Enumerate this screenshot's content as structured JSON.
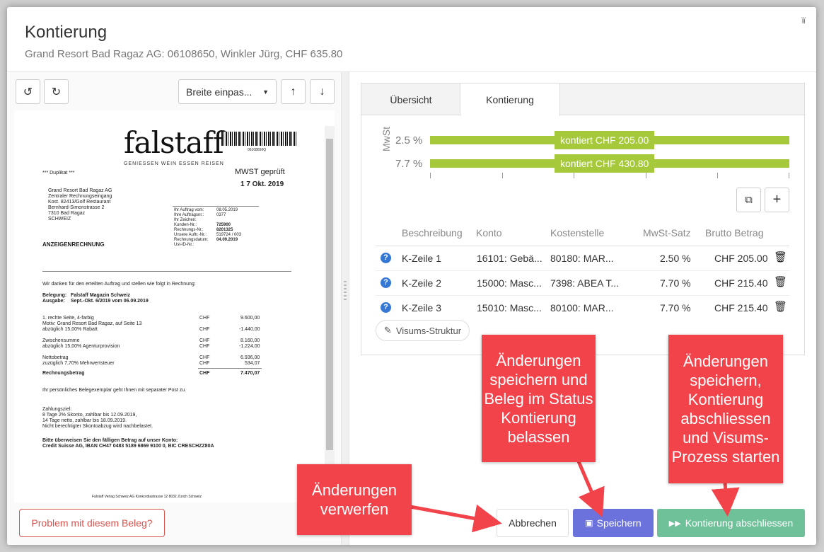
{
  "header": {
    "title": "Kontierung",
    "subtitle": "Grand Resort Bad Ragaz AG: 06108650, Winkler Jürg, CHF 635.80",
    "corner": "ïï"
  },
  "toolbar": {
    "zoom_value": "Breite einpas...",
    "rotate_left": "↺",
    "rotate_right": "↻",
    "up": "↑",
    "down": "↓"
  },
  "doc": {
    "logo": "falstaff",
    "tagline": "GENIESSEN WEIN ESSEN REISEN",
    "barcode_num": "06108650Q",
    "duplikat": "*** Duplikat ***",
    "stamp1": "MWST geprüft",
    "stamp2": "1 7 Okt. 2019",
    "addr": [
      "Grand Resort Bad Ragaz AG",
      "Zentraler Rechnungseingang",
      "Kost. 82413/Golf Restaurant",
      "Bernhard-Simonstrasse 2",
      "7310 Bad Ragaz",
      "SCHWEIZ"
    ],
    "meta_labels": [
      "Ihr Auftrag vom:",
      "Ihre Auftragsnr.:",
      "Ihr Zeichen:",
      "Kunden-Nr.:",
      "Rechnungs-Nr.:",
      "Unsere Auftr.-Nr.:",
      "Rechnungsdatum:",
      "Ust-ID-Nr.:"
    ],
    "meta_values": [
      "08.05.2019",
      "0377",
      "",
      "725900",
      "8201325",
      "519724 / 003",
      "04.09.2019",
      ""
    ],
    "doctitle": "ANZEIGENRECHNUNG",
    "thanks": "Wir danken für den erteilten Auftrag und stellen wie folgt in Rechnung:",
    "beleg_label": "Belegung:",
    "beleg_val": "Falstaff Magazin Schweiz",
    "ausg_label": "Ausgabe:",
    "ausg_val": "Sept.-Okt. 6/2019 vom 06.09.2019",
    "line1": "1. rechte Seite, 4-farbig",
    "line1b": "Motiv: Grand Resort Bad Ragaz, auf Seite 13",
    "line1c": "abzüglich 15,00% Rabatt",
    "chf": "CHF",
    "v1": "9.600,00",
    "v2": "-1.440,00",
    "zw": "Zwischensumme",
    "zwb": "abzüglich 15,00% Agenturprovision",
    "v3": "8.160,00",
    "v4": "-1.224,00",
    "netto": "Nettobetrag",
    "nettob": "zuzüglich  7,70% Mehrwertsteuer",
    "v5": "6.936,00",
    "v6": "534,07",
    "rb": "Rechnungsbetrag",
    "v7": "7.470,07",
    "pers": "Ihr persönliches Belegexemplar geht Ihnen mit separater Post zu.",
    "z1": "Zahlungsziel:",
    "z2": "8 Tage 2% Skonto, zahlbar bis 12.09.2019,",
    "z3": "14 Tage netto, zahlbar bis 18.09.2019.",
    "z4": "Nicht berechtigter Skontoabzug wird nachbelastet.",
    "b1": "Bitte überweisen Sie den fälligen Betrag auf unser Konto:",
    "b2": "Credit Suisse AG, IBAN CH47 0483 5189 6869 9100 0, BIC  CRESCHZZ80A",
    "footer": "Falstaff Verlag Schweiz AG   Konkordiastrasse 12   8032 Zürich   Schweiz"
  },
  "problem_button": "Problem mit diesem Beleg?",
  "tabs": [
    "Übersicht",
    "Kontierung"
  ],
  "mwst": {
    "axis_label": "MwSt",
    "rows": [
      {
        "rate": "2.5 %",
        "label": "kontiert CHF 205.00",
        "fraction": 1.0
      },
      {
        "rate": "7.7 %",
        "label": "kontiert CHF 430.80",
        "fraction": 1.0
      }
    ]
  },
  "table": {
    "headers": [
      "Beschreibung",
      "Konto",
      "Kostenstelle",
      "MwSt-Satz",
      "Brutto Betrag"
    ],
    "rows": [
      {
        "desc": "K-Zeile 1",
        "konto": "16101: Gebä...",
        "kst": "80180: MAR...",
        "mwst": "2.50 %",
        "brutto": "CHF 205.00"
      },
      {
        "desc": "K-Zeile 2",
        "konto": "15000: Masc...",
        "kst": "7398: ABEA T...",
        "mwst": "7.70 %",
        "brutto": "CHF 215.40"
      },
      {
        "desc": "K-Zeile 3",
        "konto": "15010: Masc...",
        "kst": "80100: MAR...",
        "mwst": "7.70 %",
        "brutto": "CHF 215.40"
      }
    ]
  },
  "visum_button": "Visums-Struktur",
  "footer": {
    "cancel": "Abbrechen",
    "save": "Speichern",
    "finish": "Kontierung abschliessen"
  },
  "callouts": {
    "discard": "Änderungen verwerfen",
    "save": "Änderungen speichern und Beleg im Status Kontierung belassen",
    "finish": "Änderungen speichern, Kontierung abschliessen und Visums-Prozess starten"
  },
  "colors": {
    "bar": "#a5c93b",
    "save": "#6c72dc",
    "finish": "#6fc19a",
    "callout": "#f2424a",
    "danger": "#d9534f"
  }
}
